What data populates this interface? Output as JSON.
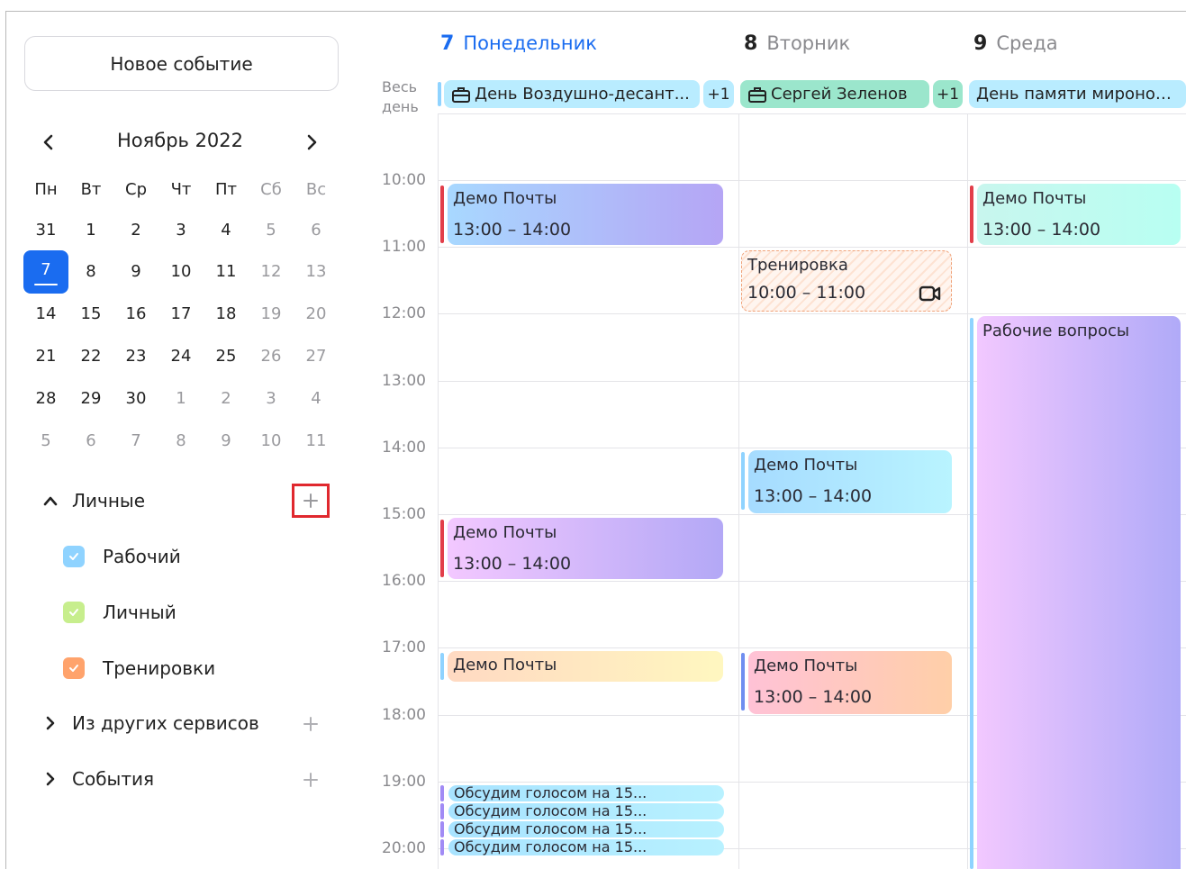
{
  "sidebar": {
    "new_event_label": "Новое событие",
    "month_title": "Ноябрь 2022",
    "weekdays": [
      "Пн",
      "Вт",
      "Ср",
      "Чт",
      "Пт",
      "Сб",
      "Вс"
    ],
    "weeks": [
      [
        "31",
        "1",
        "2",
        "3",
        "4",
        "5",
        "6"
      ],
      [
        "7",
        "8",
        "9",
        "10",
        "11",
        "12",
        "13"
      ],
      [
        "14",
        "15",
        "16",
        "17",
        "18",
        "19",
        "20"
      ],
      [
        "21",
        "22",
        "23",
        "24",
        "25",
        "26",
        "27"
      ],
      [
        "28",
        "29",
        "30",
        "1",
        "2",
        "3",
        "4"
      ],
      [
        "5",
        "6",
        "7",
        "8",
        "9",
        "10",
        "11"
      ]
    ],
    "today": "7",
    "sections": {
      "personal": "Личные",
      "other_services": "Из других сервисов",
      "events": "События"
    },
    "calendars": [
      {
        "label": "Рабочий",
        "color": "#8fd3ff"
      },
      {
        "label": "Личный",
        "color": "#c7ee8d"
      },
      {
        "label": "Тренировки",
        "color": "#ffa36c"
      }
    ]
  },
  "main": {
    "days": [
      {
        "num": "7",
        "name": "Понедельник"
      },
      {
        "num": "8",
        "name": "Вторник"
      },
      {
        "num": "9",
        "name": "Среда"
      }
    ],
    "allday_label": "Весь день",
    "allday": [
      {
        "text": "День Воздушно-десант...",
        "more": "+1"
      },
      {
        "text": "Сергей Зеленов",
        "more": "+1"
      },
      {
        "text": "День памяти мироноси..."
      }
    ],
    "hours": [
      "10:00",
      "11:00",
      "12:00",
      "13:00",
      "14:00",
      "15:00",
      "16:00",
      "17:00",
      "18:00",
      "19:00",
      "20:00"
    ],
    "events": {
      "mon1": {
        "title": "Демо Почты",
        "time": "13:00 – 14:00"
      },
      "mon2": {
        "title": "Демо Почты",
        "time": "13:00 – 14:00"
      },
      "mon3": {
        "title": "Демо Почты"
      },
      "mon_small": [
        "Обсудим голосом на 15...",
        "Обсудим голосом на 15...",
        "Обсудим голосом на 15...",
        "Обсудим голосом на 15..."
      ],
      "tue_training": {
        "title": "Тренировка",
        "time": "10:00 – 11:00"
      },
      "tue1": {
        "title": "Демо Почты",
        "time": "13:00 – 14:00"
      },
      "tue2": {
        "title": "Демо Почты",
        "time": "13:00 – 14:00"
      },
      "wed1": {
        "title": "Демо Почты",
        "time": "13:00 – 14:00"
      },
      "wed2": {
        "title": "Рабочие вопросы"
      }
    }
  },
  "colors": {
    "accent": "#1a6cf0",
    "highlight_box": "#e0282e"
  }
}
